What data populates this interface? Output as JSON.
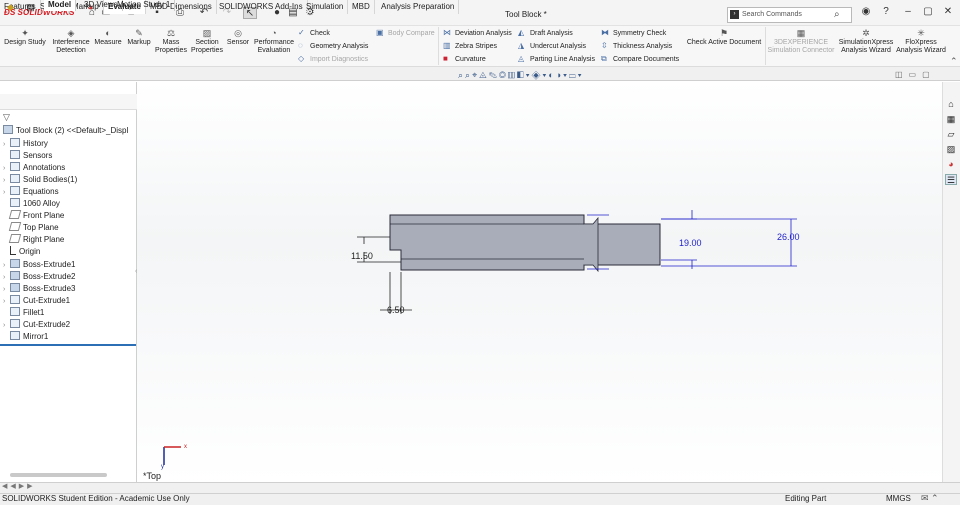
{
  "app": {
    "brand": "SOLIDWORKS",
    "document_title": "Tool Block *"
  },
  "search": {
    "placeholder": "Search Commands"
  },
  "ribbon": {
    "large_buttons": [
      {
        "label1": "Design Study",
        "label2": ""
      },
      {
        "label1": "Interference",
        "label2": "Detection"
      },
      {
        "label1": "Measure",
        "label2": ""
      },
      {
        "label1": "Markup",
        "label2": ""
      },
      {
        "label1": "Mass",
        "label2": "Properties"
      },
      {
        "label1": "Section",
        "label2": "Properties"
      },
      {
        "label1": "Sensor",
        "label2": ""
      },
      {
        "label1": "Performance",
        "label2": "Evaluation"
      }
    ],
    "col1": [
      "Check",
      "Geometry Analysis",
      "Import Diagnostics"
    ],
    "body_compare": "Body Compare",
    "col2": [
      "Deviation Analysis",
      "Zebra Stripes",
      "Curvature"
    ],
    "col3": [
      "Draft Analysis",
      "Undercut Analysis",
      "Parting Line Analysis"
    ],
    "col4": [
      "Symmetry Check",
      "Thickness Analysis",
      "Compare Documents"
    ],
    "check_active": "Check Active Document",
    "simconn": {
      "label1": "3DEXPERIENCE",
      "label2": "Simulation Connector"
    },
    "simx": {
      "label1": "SimulationXpress",
      "label2": "Analysis Wizard"
    },
    "flox": {
      "label1": "FloXpress",
      "label2": "Analysis Wizard"
    }
  },
  "tabs": [
    "Features",
    "Sketch",
    "Markup",
    "Evaluate",
    "MBD Dimensions",
    "SOLIDWORKS Add-Ins",
    "Simulation",
    "MBD",
    "Analysis Preparation"
  ],
  "active_tab": "Evaluate",
  "tree": {
    "root": "Tool Block (2) <<Default>_Displ",
    "items": [
      "History",
      "Sensors",
      "Annotations",
      "Solid Bodies(1)",
      "Equations",
      "1060 Alloy",
      "Front Plane",
      "Top Plane",
      "Right Plane",
      "Origin",
      "Boss-Extrude1",
      "Boss-Extrude2",
      "Boss-Extrude3",
      "Cut-Extrude1",
      "Fillet1",
      "Cut-Extrude2",
      "Mirror1"
    ]
  },
  "dimensions": {
    "d1": "11.50",
    "d2": "19.00",
    "d3": "26.00",
    "d4": "6.50"
  },
  "view_label": "*Top",
  "bottom_tabs": [
    "Model",
    "3D Views",
    "Motion Study 1"
  ],
  "status": {
    "left": "SOLIDWORKS Student Edition - Academic Use Only",
    "mode": "Editing Part",
    "units": "MMGS"
  },
  "colors": {
    "accent": "#2d6fb5",
    "part_fill": "#a9adb9",
    "dimension": "#1f1fcc",
    "brand_red": "#d71920"
  }
}
